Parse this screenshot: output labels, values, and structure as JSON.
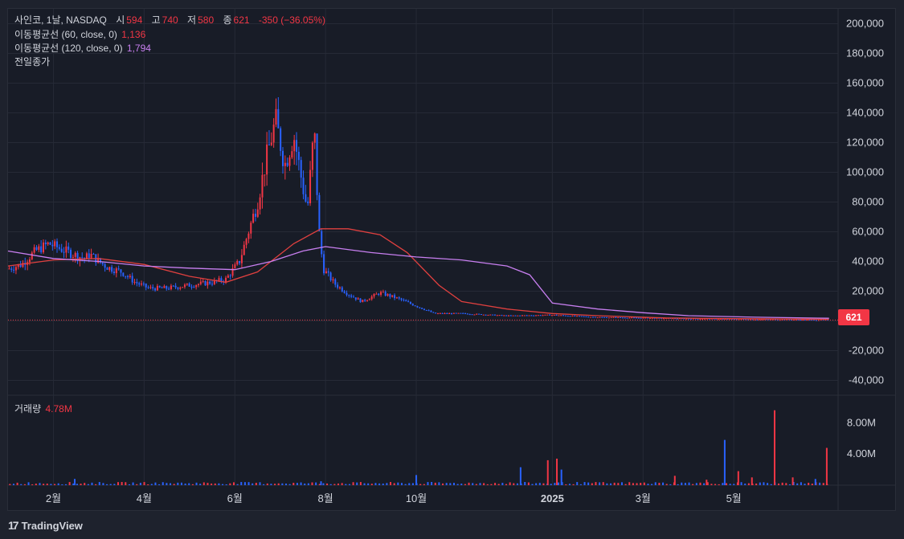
{
  "legend": {
    "symbol": "사인코, 1날, NASDAQ",
    "open_label": "시",
    "open": "594",
    "high_label": "고",
    "high": "740",
    "low_label": "저",
    "low": "580",
    "close_label": "종",
    "close": "621",
    "change": "-350 (−36.05%)",
    "ma60_label": "이동평균선 (60, close, 0)",
    "ma60_value": "1,136",
    "ma120_label": "이동평균선 (120, close, 0)",
    "ma120_value": "1,794",
    "prev_close_label": "전일종가",
    "volume_label": "거래량",
    "volume_value": "4.78M"
  },
  "price_tag": "621",
  "brand": {
    "logo": "17",
    "name": "TradingView"
  },
  "colors": {
    "up": "#f23645",
    "down": "#2962ff",
    "ma60": "#e0403f",
    "ma120": "#c87ff0",
    "background": "#181c27",
    "grid": "#262a36",
    "text": "#d1d4dc"
  },
  "chart_data": [
    {
      "type": "candlestick",
      "title": "",
      "y_axis": {
        "ticks": [
          "200,000",
          "180,000",
          "160,000",
          "140,000",
          "120,000",
          "100,000",
          "80,000",
          "60,000",
          "40,000",
          "20,000",
          "-20,000",
          "-40,000"
        ],
        "tick_values": [
          200000,
          180000,
          160000,
          140000,
          120000,
          100000,
          80000,
          60000,
          40000,
          20000,
          -20000,
          -40000
        ],
        "range": [
          -50000,
          210000
        ]
      },
      "x_axis": {
        "ticks": [
          "2월",
          "4월",
          "6월",
          "8월",
          "10월",
          "2025",
          "3월",
          "5월"
        ],
        "tick_months": [
          1,
          3,
          5,
          7,
          9,
          12,
          14,
          16
        ]
      },
      "x_range_months": [
        0,
        18.3
      ],
      "last_close": 621,
      "close_series_approx": [
        {
          "m": 0.0,
          "v": 35000
        },
        {
          "m": 0.3,
          "v": 38000
        },
        {
          "m": 0.6,
          "v": 47000
        },
        {
          "m": 0.9,
          "v": 52000
        },
        {
          "m": 1.2,
          "v": 48000
        },
        {
          "m": 1.5,
          "v": 44000
        },
        {
          "m": 1.7,
          "v": 42000
        },
        {
          "m": 1.8,
          "v": 45000
        },
        {
          "m": 2.0,
          "v": 40000
        },
        {
          "m": 2.2,
          "v": 36000
        },
        {
          "m": 2.5,
          "v": 33000
        },
        {
          "m": 2.8,
          "v": 26000
        },
        {
          "m": 3.1,
          "v": 22000
        },
        {
          "m": 3.5,
          "v": 22000
        },
        {
          "m": 4.0,
          "v": 24000
        },
        {
          "m": 4.5,
          "v": 26000
        },
        {
          "m": 4.8,
          "v": 28000
        },
        {
          "m": 5.1,
          "v": 40000
        },
        {
          "m": 5.3,
          "v": 60000
        },
        {
          "m": 5.5,
          "v": 80000
        },
        {
          "m": 5.7,
          "v": 110000
        },
        {
          "m": 5.9,
          "v": 135000
        },
        {
          "m": 6.1,
          "v": 105000
        },
        {
          "m": 6.3,
          "v": 125000
        },
        {
          "m": 6.5,
          "v": 90000
        },
        {
          "m": 6.6,
          "v": 75000
        },
        {
          "m": 6.75,
          "v": 130000
        },
        {
          "m": 6.85,
          "v": 62000
        },
        {
          "m": 6.95,
          "v": 35000
        },
        {
          "m": 7.2,
          "v": 25000
        },
        {
          "m": 7.5,
          "v": 18000
        },
        {
          "m": 7.8,
          "v": 13000
        },
        {
          "m": 8.2,
          "v": 19000
        },
        {
          "m": 8.6,
          "v": 15000
        },
        {
          "m": 9.0,
          "v": 10000
        },
        {
          "m": 9.4,
          "v": 5000
        },
        {
          "m": 10.0,
          "v": 5000
        },
        {
          "m": 11.0,
          "v": 3500
        },
        {
          "m": 12.0,
          "v": 4000
        },
        {
          "m": 13.0,
          "v": 2500
        },
        {
          "m": 14.0,
          "v": 2000
        },
        {
          "m": 15.0,
          "v": 1500
        },
        {
          "m": 16.0,
          "v": 1200
        },
        {
          "m": 17.0,
          "v": 900
        },
        {
          "m": 18.1,
          "v": 621
        }
      ],
      "series": [
        {
          "name": "이동평균선 (60, close, 0)",
          "points": [
            {
              "m": 0.0,
              "v": 37000
            },
            {
              "m": 1.0,
              "v": 41000
            },
            {
              "m": 2.0,
              "v": 42000
            },
            {
              "m": 3.0,
              "v": 38000
            },
            {
              "m": 4.0,
              "v": 30000
            },
            {
              "m": 4.8,
              "v": 26000
            },
            {
              "m": 5.5,
              "v": 33000
            },
            {
              "m": 6.3,
              "v": 52000
            },
            {
              "m": 6.9,
              "v": 62000
            },
            {
              "m": 7.5,
              "v": 62000
            },
            {
              "m": 8.2,
              "v": 58000
            },
            {
              "m": 8.8,
              "v": 46000
            },
            {
              "m": 9.5,
              "v": 24000
            },
            {
              "m": 10.0,
              "v": 13000
            },
            {
              "m": 11.0,
              "v": 8000
            },
            {
              "m": 12.0,
              "v": 5000
            },
            {
              "m": 13.0,
              "v": 3500
            },
            {
              "m": 14.5,
              "v": 2000
            },
            {
              "m": 16.0,
              "v": 1500
            },
            {
              "m": 18.1,
              "v": 1136
            }
          ]
        },
        {
          "name": "이동평균선 (120, close, 0)",
          "points": [
            {
              "m": 0.0,
              "v": 47000
            },
            {
              "m": 1.0,
              "v": 42000
            },
            {
              "m": 2.0,
              "v": 40000
            },
            {
              "m": 3.0,
              "v": 37000
            },
            {
              "m": 4.0,
              "v": 35500
            },
            {
              "m": 5.0,
              "v": 34500
            },
            {
              "m": 5.8,
              "v": 40000
            },
            {
              "m": 6.5,
              "v": 47000
            },
            {
              "m": 7.0,
              "v": 50000
            },
            {
              "m": 8.0,
              "v": 46000
            },
            {
              "m": 9.0,
              "v": 43000
            },
            {
              "m": 10.0,
              "v": 41000
            },
            {
              "m": 11.0,
              "v": 37000
            },
            {
              "m": 11.5,
              "v": 31000
            },
            {
              "m": 12.0,
              "v": 12000
            },
            {
              "m": 13.0,
              "v": 8000
            },
            {
              "m": 14.0,
              "v": 5500
            },
            {
              "m": 15.0,
              "v": 3500
            },
            {
              "m": 16.5,
              "v": 2500
            },
            {
              "m": 18.1,
              "v": 1794
            }
          ]
        }
      ],
      "volume": {
        "label": "거래량",
        "last": "4.78M",
        "y_axis": {
          "ticks": [
            "8.00M",
            "4.00M"
          ],
          "tick_values": [
            8000000,
            4000000
          ],
          "range": [
            0,
            10500000
          ]
        },
        "bars": [
          {
            "m": 1.47,
            "v": 800000,
            "dir": "down"
          },
          {
            "m": 6.9,
            "v": 500000,
            "dir": "down"
          },
          {
            "m": 9.0,
            "v": 1300000,
            "dir": "down"
          },
          {
            "m": 11.3,
            "v": 2300000,
            "dir": "down"
          },
          {
            "m": 11.9,
            "v": 3200000,
            "dir": "up"
          },
          {
            "m": 12.1,
            "v": 3400000,
            "dir": "up"
          },
          {
            "m": 12.2,
            "v": 2000000,
            "dir": "down"
          },
          {
            "m": 14.7,
            "v": 1200000,
            "dir": "up"
          },
          {
            "m": 15.4,
            "v": 700000,
            "dir": "up"
          },
          {
            "m": 15.8,
            "v": 5800000,
            "dir": "down"
          },
          {
            "m": 16.1,
            "v": 1800000,
            "dir": "up"
          },
          {
            "m": 16.4,
            "v": 1000000,
            "dir": "up"
          },
          {
            "m": 16.9,
            "v": 9600000,
            "dir": "up"
          },
          {
            "m": 17.3,
            "v": 1000000,
            "dir": "up"
          },
          {
            "m": 17.8,
            "v": 800000,
            "dir": "down"
          },
          {
            "m": 18.05,
            "v": 4780000,
            "dir": "up"
          }
        ]
      }
    }
  ]
}
